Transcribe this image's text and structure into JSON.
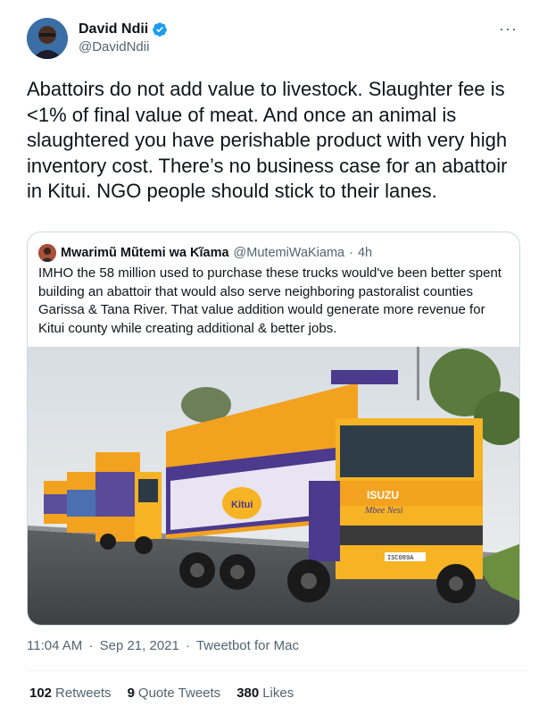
{
  "author": {
    "display_name": "David Ndii",
    "handle": "@DavidNdii",
    "verified": true,
    "more_glyph": "···"
  },
  "tweet": {
    "text": "Abattoirs do not add value to livestock. Slaughter fee is <1% of final value of meat. And once an animal is slaughtered you have  perishable product with very high inventory cost. There’s no business case for an abattoir in Kitui. NGO people should stick to their lanes."
  },
  "quoted_tweet": {
    "display_name": "Mwarimũ Mũtemi wa Kĩama",
    "handle": "@MutemiWaKiama",
    "separator": "·",
    "time": "4h",
    "text": "IMHO the 58 million used to purchase these trucks would've been better spent building an abattoir that would also serve neighboring pastoralist counties Garissa & Tana River. That value addition would generate more revenue for Kitui county while creating additional & better jobs.",
    "image": {
      "cab_brand": "ISUZU",
      "cab_script": "Mbee Nesi",
      "side_logo": "Kitui",
      "plate": "ISC089A"
    }
  },
  "meta": {
    "time": "11:04 AM",
    "date": "Sep 21, 2021",
    "source": "Tweetbot for Mac",
    "separator": "·"
  },
  "stats": {
    "retweets_count": "102",
    "retweets_label": "Retweets",
    "quotes_count": "9",
    "quotes_label": "Quote Tweets",
    "likes_count": "380",
    "likes_label": "Likes"
  },
  "colors": {
    "verified_blue": "#1d9bf0",
    "truck_orange": "#f3a21f",
    "truck_yellow": "#f6b323",
    "truck_purple": "#4b3a8e"
  }
}
